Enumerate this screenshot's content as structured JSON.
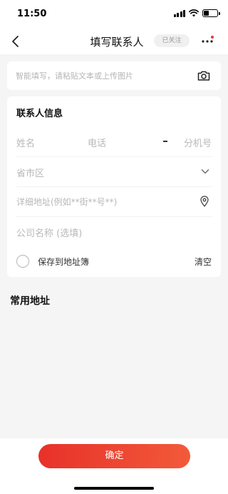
{
  "status": {
    "time": "11:50"
  },
  "nav": {
    "title": "填写联系人",
    "follow_badge": "已关注"
  },
  "smart_fill": {
    "placeholder": "智能填写，请粘贴文本或上传图片"
  },
  "contact": {
    "section_title": "联系人信息",
    "name_placeholder": "姓名",
    "phone_placeholder": "电话",
    "extension_placeholder": "分机号",
    "region_placeholder": "省市区",
    "address_placeholder": "详细地址(例如**街**号**)",
    "company_placeholder": "公司名称 (选填)",
    "save_label": "保存到地址簿",
    "clear_label": "清空"
  },
  "common": {
    "title": "常用地址"
  },
  "footer": {
    "confirm_label": "确定"
  },
  "colors": {
    "accent_start": "#e8312a",
    "accent_end": "#f25a39",
    "notification_dot": "#e4393c"
  },
  "icons": [
    "back-icon",
    "more-icon",
    "camera-icon",
    "chevron-down-icon",
    "location-pin-icon",
    "wifi-icon",
    "signal-icon",
    "battery-icon"
  ]
}
